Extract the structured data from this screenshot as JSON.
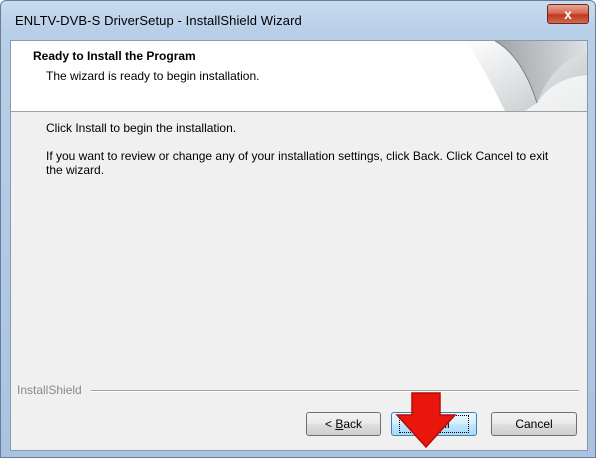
{
  "window": {
    "title": "ENLTV-DVB-S DriverSetup - InstallShield Wizard",
    "close_label": "x"
  },
  "header": {
    "title": "Ready to Install the Program",
    "subtitle": "The wizard is ready to begin installation."
  },
  "body": {
    "line1": "Click Install to begin the installation.",
    "line2": "If you want to review or change any of your installation settings, click Back. Click Cancel to exit the wizard."
  },
  "footer": {
    "brand": "InstallShield"
  },
  "buttons": {
    "back_prefix": "< ",
    "back_accel": "B",
    "back_rest": "ack",
    "install_accel": "I",
    "install_rest": "nstall",
    "cancel": "Cancel"
  },
  "colors": {
    "arrow": "#e8160c",
    "close_button": "#c8462c"
  },
  "icons": {
    "close": "close-icon",
    "arrow": "down-arrow-icon",
    "header_art": "page-curl-graphic"
  }
}
